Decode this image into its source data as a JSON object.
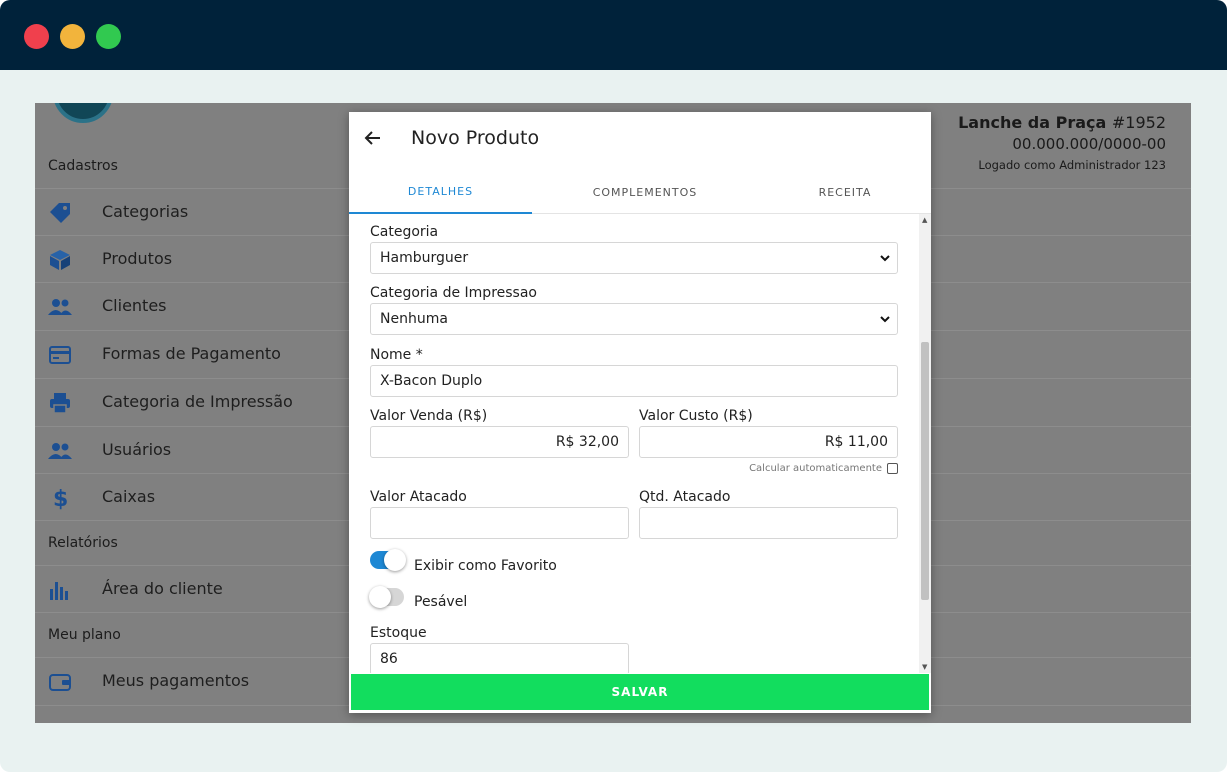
{
  "store": {
    "name": "Lanche da Praça",
    "number": "#1952",
    "cnpj": "00.000.000/0000-00",
    "logged_as": "Logado como Administrador 123"
  },
  "sidebar": {
    "sections": {
      "cadastros": "Cadastros",
      "relatorios": "Relatórios",
      "meu_plano": "Meu plano"
    },
    "items": [
      {
        "label": "Categorias",
        "icon": "tag-icon"
      },
      {
        "label": "Produtos",
        "icon": "box-icon"
      },
      {
        "label": "Clientes",
        "icon": "users-icon"
      },
      {
        "label": "Formas de Pagamento",
        "icon": "credit-card-icon"
      },
      {
        "label": "Categoria de Impressão",
        "icon": "printer-icon"
      },
      {
        "label": "Usuários",
        "icon": "users-icon"
      },
      {
        "label": "Caixas",
        "icon": "dollar-icon"
      },
      {
        "label": "Área do cliente",
        "icon": "bar-chart-icon"
      },
      {
        "label": "Meus pagamentos",
        "icon": "wallet-icon"
      }
    ]
  },
  "modal": {
    "title": "Novo Produto",
    "tabs": [
      "DETALHES",
      "COMPLEMENTOS",
      "RECEITA"
    ],
    "active_tab": "DETALHES",
    "fields": {
      "categoria": {
        "label": "Categoria",
        "value": "Hamburguer"
      },
      "categoria_impressao": {
        "label": "Categoria de Impressao",
        "value": "Nenhuma"
      },
      "nome": {
        "label": "Nome *",
        "value": "X-Bacon Duplo"
      },
      "valor_venda": {
        "label": "Valor Venda (R$)",
        "value": "R$ 32,00"
      },
      "valor_custo": {
        "label": "Valor Custo (R$)",
        "value": "R$ 11,00"
      },
      "calcular": {
        "label": "Calcular automaticamente",
        "checked": false
      },
      "valor_atacado": {
        "label": "Valor Atacado",
        "value": ""
      },
      "qtd_atacado": {
        "label": "Qtd. Atacado",
        "value": ""
      },
      "favorito": {
        "label": "Exibir como Favorito",
        "on": true
      },
      "pesavel": {
        "label": "Pesável",
        "on": false
      },
      "estoque": {
        "label": "Estoque",
        "value": "86"
      }
    },
    "save_label": "SALVAR"
  },
  "colors": {
    "titlebar": "#00223a",
    "accent": "#1e88d4",
    "save": "#12dd5e",
    "sidebar_icon": "#1c4f92"
  }
}
